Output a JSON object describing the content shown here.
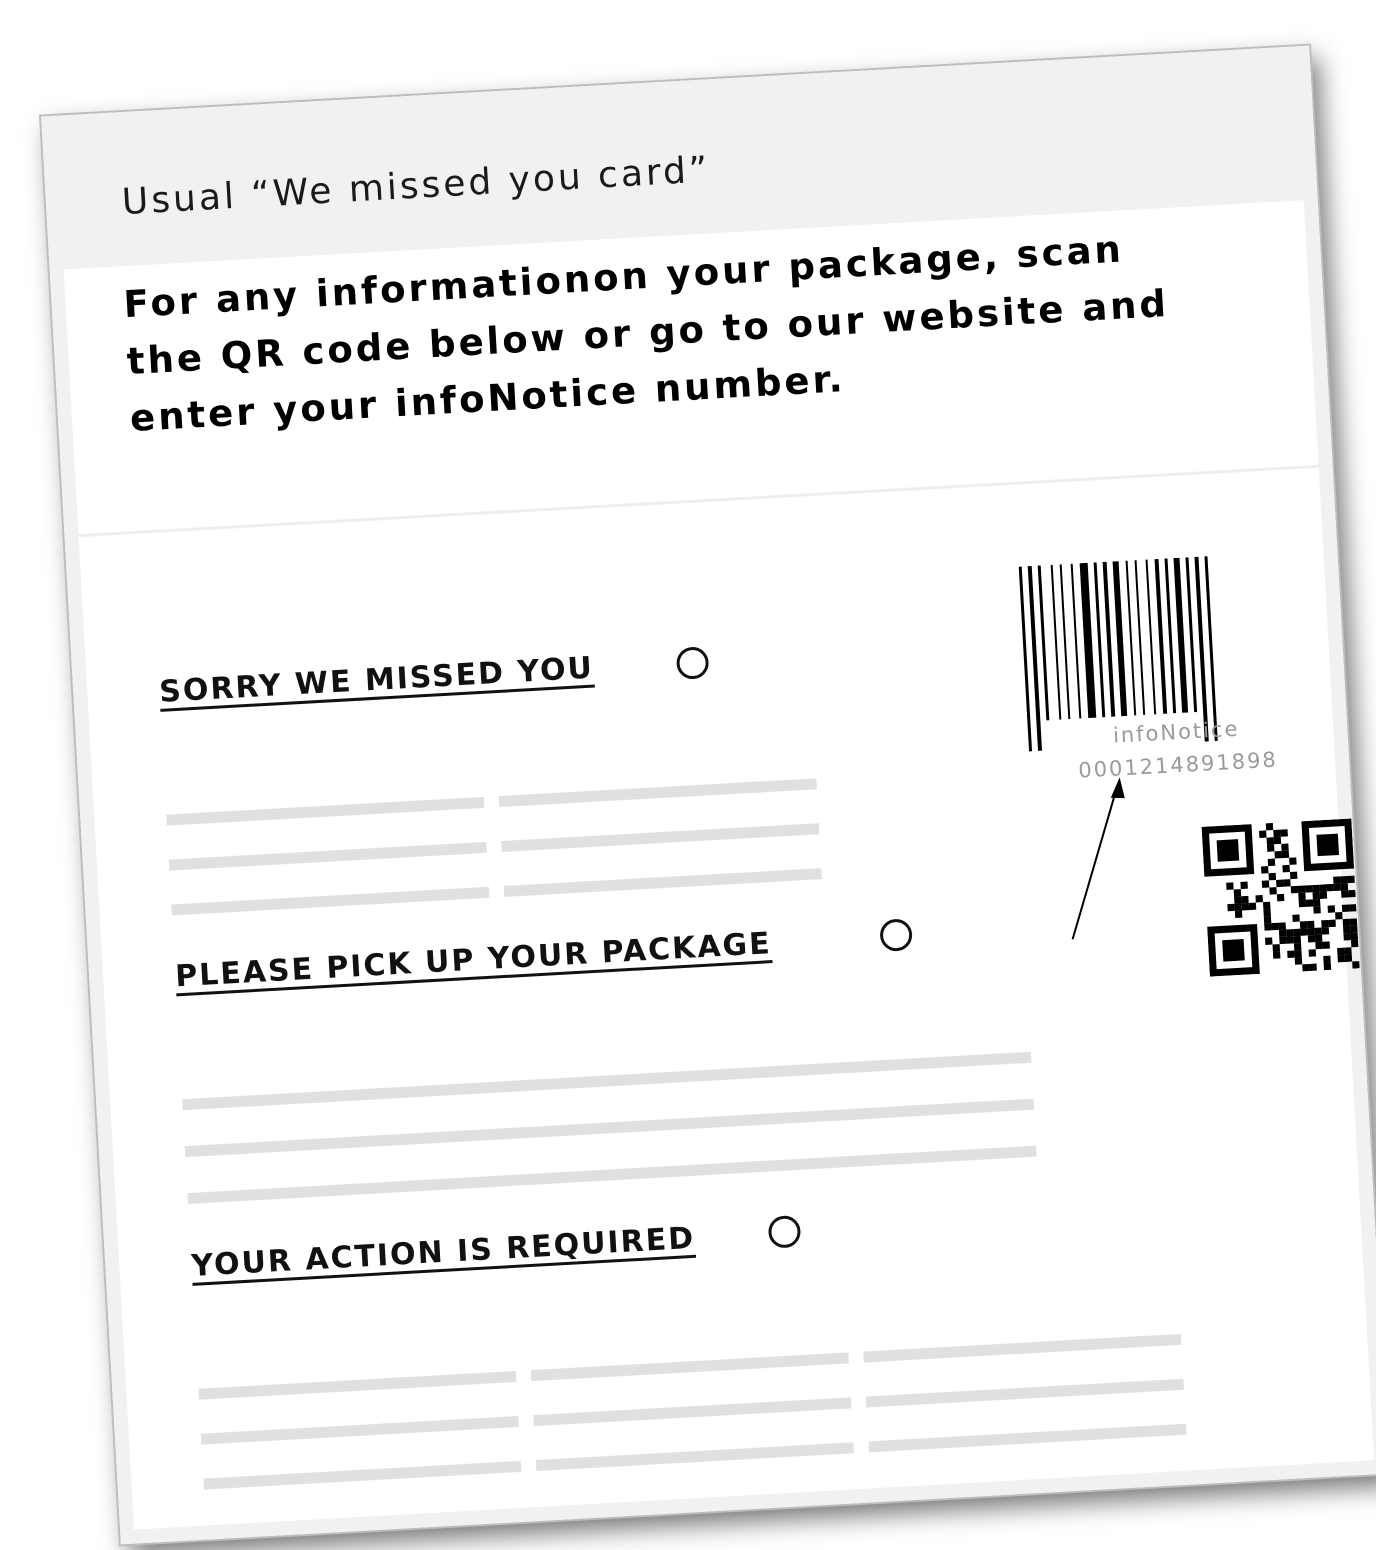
{
  "card": {
    "title": "Usual “We missed you card”",
    "intro_lines": [
      "For any informationon your package, scan",
      "the QR code below or go to our website and",
      "enter your infoNotice number."
    ]
  },
  "options": [
    {
      "label": "SORRY WE MISSED YOU"
    },
    {
      "label": "PLEASE PICK UP YOUR PACKAGE"
    },
    {
      "label": "YOUR ACTION IS REQUIRED"
    }
  ],
  "barcode": {
    "caption": "infoNotice",
    "number": "0001214891898"
  },
  "icons": {
    "barcode": "barcode-icon",
    "qr": "qr-code-icon",
    "arrow": "arrow-icon",
    "radio": "radio-circle-icon"
  },
  "colors": {
    "header_band": "#f1f1f1",
    "placeholder_line": "#e0e0e0",
    "ink": "#000000",
    "caption": "#9a9a9a"
  }
}
